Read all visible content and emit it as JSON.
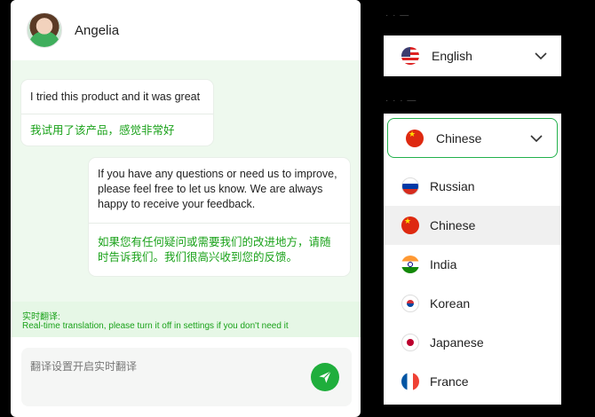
{
  "chat": {
    "contact_name": "Angelia",
    "messages": [
      {
        "original": "I tried this product and it was great",
        "translation": "我试用了该产品，感觉非常好"
      },
      {
        "original": "If you have any questions or need us to improve, please feel free to let us know. We are always happy to receive your feedback.",
        "translation": "如果您有任何疑问或需要我们的改进地方，请随时告诉我们。我们很高兴收到您的反馈。"
      }
    ],
    "realtime": {
      "title": "实时翻译:",
      "subtitle": "Real-time translation, please turn it off in settings if you don't need it"
    },
    "input": {
      "placeholder": "翻译设置开启实时翻译"
    }
  },
  "language_settings": {
    "source": {
      "selected": "English",
      "flag": "us-flag-icon"
    },
    "target": {
      "selected": "Chinese",
      "flag": "cn-flag-icon"
    },
    "options": [
      {
        "label": "Russian",
        "flag": "ru-flag-icon"
      },
      {
        "label": "Chinese",
        "flag": "cn-flag-icon",
        "selected": true
      },
      {
        "label": "India",
        "flag": "in-flag-icon"
      },
      {
        "label": "Korean",
        "flag": "kr-flag-icon"
      },
      {
        "label": "Japanese",
        "flag": "jp-flag-icon"
      },
      {
        "label": "France",
        "flag": "fr-flag-icon"
      }
    ]
  },
  "colors": {
    "accent": "#1aa21a",
    "send_button": "#1fae3c",
    "chat_bg": "#eef9ee"
  }
}
